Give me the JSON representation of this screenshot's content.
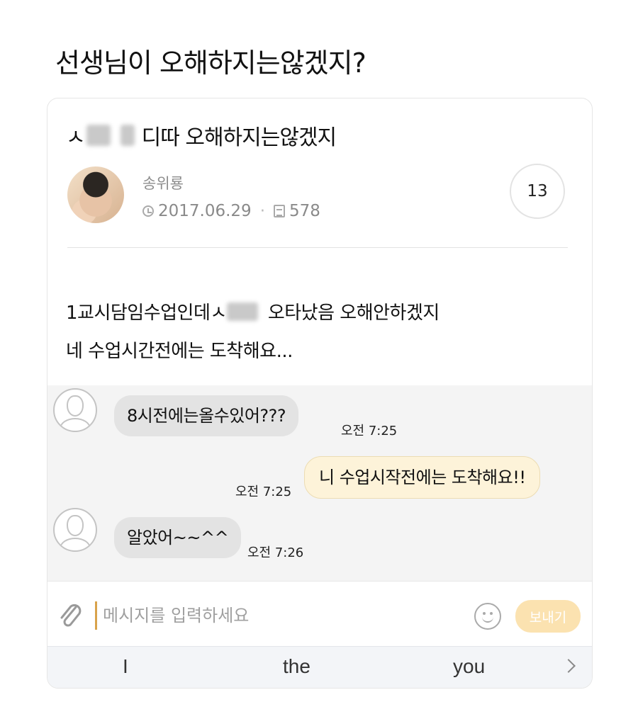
{
  "page": {
    "title": "선생님이 오해하지는않겠지?"
  },
  "post": {
    "title_prefix": "ㅅ",
    "title_suffix": "디따 오해하지는않겠지",
    "author": "송위룡",
    "date": "2017.06.29",
    "views": "578",
    "comment_count": "13",
    "body_line1_prefix": "1교시담임수업인데ㅅ",
    "body_line1_suffix": "오타났음 오해안하겠지",
    "body_line2": "네 수업시간전에는 도착해요..."
  },
  "chat": {
    "messages": [
      {
        "text": "8시전에는올수있어???",
        "time": "오전 7:25",
        "direction": "incoming"
      },
      {
        "text": "니 수업시작전에는 도착해요!!",
        "time": "오전 7:25",
        "direction": "outgoing"
      },
      {
        "text": "알았어~~^^",
        "time": "오전 7:26",
        "direction": "incoming"
      }
    ]
  },
  "composer": {
    "placeholder": "메시지를 입력하세요",
    "send_label": "보내기"
  },
  "keyboard": {
    "suggestions": [
      "I",
      "the",
      "you"
    ]
  },
  "colors": {
    "outgoing_bubble": "#fdf3d9",
    "incoming_bubble": "#e3e3e3",
    "send_button": "#fbe2b0"
  }
}
